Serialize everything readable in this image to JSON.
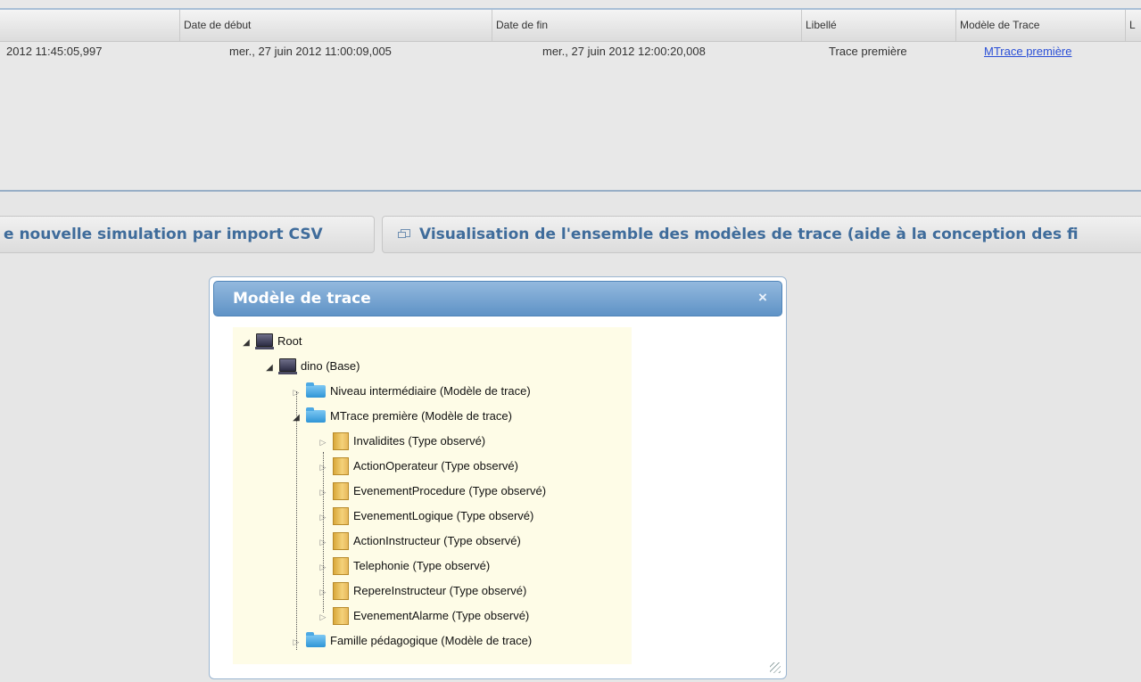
{
  "table": {
    "headers": [
      "Date de début",
      "Date de fin",
      "Libellé",
      "Modèle de Trace",
      "L"
    ],
    "row": {
      "first_col": "2012 11:45:05,997",
      "date_debut": "mer., 27 juin 2012 11:00:09,005",
      "date_fin": "mer., 27 juin 2012 12:00:20,008",
      "libelle": "Trace première",
      "modele": "MTrace première"
    }
  },
  "buttons": {
    "import_csv": "e nouvelle simulation par import CSV",
    "visualisation": "Visualisation de l'ensemble des modèles de trace (aide à la conception des fi"
  },
  "dialog": {
    "title": "Modèle de trace",
    "close": "×",
    "tree": {
      "root": "Root",
      "base": "dino (Base)",
      "niveau": "Niveau intermédiaire (Modèle de trace)",
      "mtrace": "MTrace première (Modèle de trace)",
      "children": [
        "Invalidites (Type observé)",
        "ActionOperateur (Type observé)",
        "EvenementProcedure (Type observé)",
        "EvenementLogique (Type observé)",
        "ActionInstructeur (Type observé)",
        "Telephonie (Type observé)",
        "RepereInstructeur (Type observé)",
        "EvenementAlarme (Type observé)"
      ],
      "famille": "Famille pédagogique (Modèle de trace)"
    }
  }
}
